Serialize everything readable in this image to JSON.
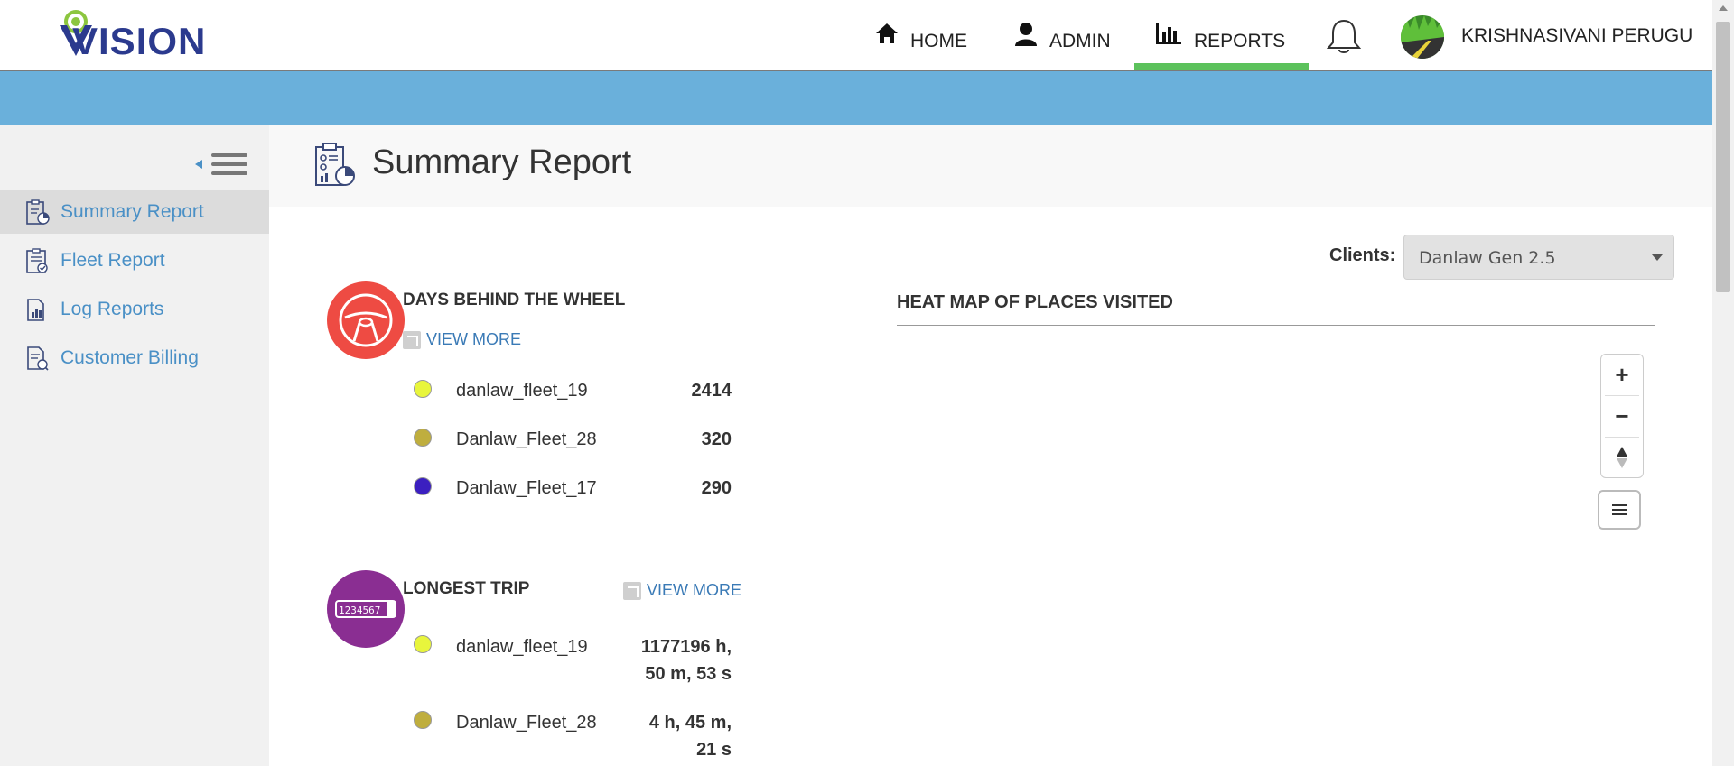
{
  "brand": {
    "name": "VISION",
    "logo_color": "#2b3a8e",
    "accent": "#8cc63f"
  },
  "nav": {
    "items": [
      {
        "label": "HOME",
        "icon": "home-icon"
      },
      {
        "label": "ADMIN",
        "icon": "user-icon"
      },
      {
        "label": "REPORTS",
        "icon": "bar-chart-icon",
        "active": true
      }
    ],
    "notifications_icon": "bell-icon",
    "user_name": "KRISHNASIVANI PERUGU"
  },
  "colors": {
    "band": "#6ab0db",
    "active_underline": "#5cc25c",
    "link": "#4a90c6"
  },
  "sidebar": {
    "items": [
      {
        "label": "Summary Report",
        "icon": "summary-report-icon",
        "active": true
      },
      {
        "label": "Fleet Report",
        "icon": "fleet-report-icon"
      },
      {
        "label": "Log Reports",
        "icon": "log-reports-icon"
      },
      {
        "label": "Customer Billing",
        "icon": "customer-billing-icon"
      }
    ]
  },
  "page": {
    "title": "Summary Report"
  },
  "clients": {
    "label": "Clients:",
    "selected": "Danlaw Gen 2.5"
  },
  "days_behind_wheel": {
    "title": "DAYS BEHIND THE WHEEL",
    "view_more": "VIEW MORE",
    "icon_color": "#ee4b43",
    "rows": [
      {
        "name": "danlaw_fleet_19",
        "value": "2414",
        "color": "#e8f53c"
      },
      {
        "name": "Danlaw_Fleet_28",
        "value": "320",
        "color": "#bfae3e"
      },
      {
        "name": "Danlaw_Fleet_17",
        "value": "290",
        "color": "#3b1fc0"
      }
    ]
  },
  "longest_trip": {
    "title": "LONGEST TRIP",
    "view_more": "VIEW MORE",
    "icon_color": "#8a2e92",
    "odometer": "1234567",
    "rows": [
      {
        "name": "danlaw_fleet_19",
        "value_line1": "1177196 h,",
        "value_line2": "50 m, 53 s",
        "color": "#e8f53c"
      },
      {
        "name": "Danlaw_Fleet_28",
        "value_line1": "4 h, 45 m,",
        "value_line2": "21 s",
        "color": "#bfae3e"
      }
    ]
  },
  "heat_map": {
    "title": "HEAT MAP OF PLACES VISITED",
    "zoom_in": "+",
    "zoom_out": "−"
  }
}
